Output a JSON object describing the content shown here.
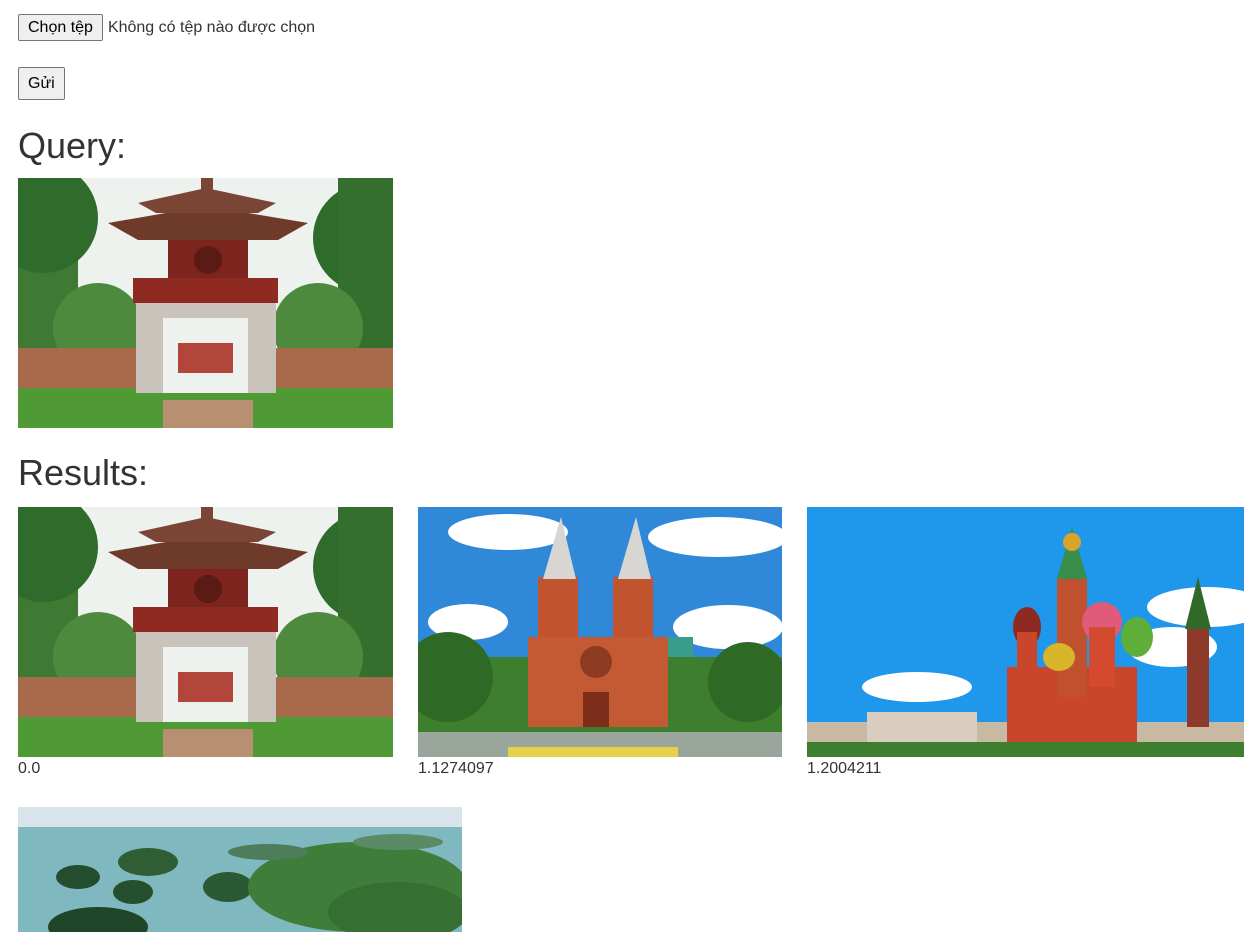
{
  "form": {
    "choose_file_label": "Chọn tệp",
    "file_status": "Không có tệp nào được chọn",
    "submit_label": "Gửi"
  },
  "query": {
    "heading": "Query:"
  },
  "results": {
    "heading": "Results:",
    "items": [
      {
        "score": "0.0"
      },
      {
        "score": "1.1274097"
      },
      {
        "score": "1.2004211"
      },
      {
        "score": ""
      }
    ]
  }
}
